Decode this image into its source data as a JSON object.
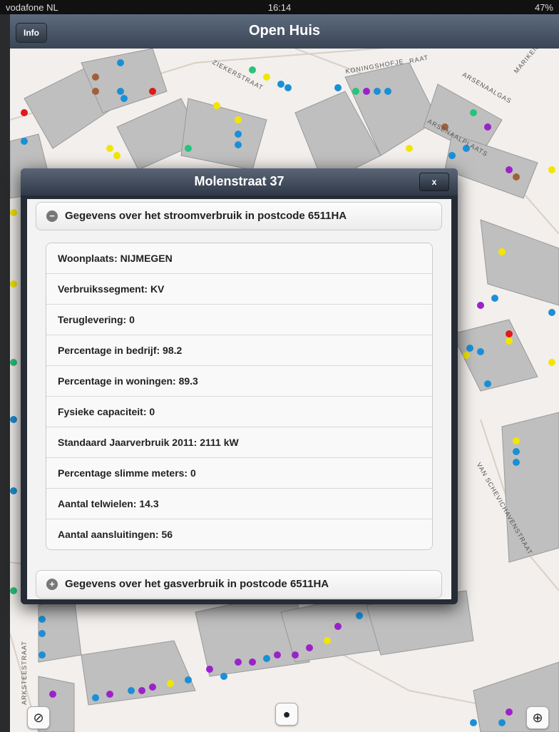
{
  "status_bar": {
    "carrier": "vodafone NL",
    "time": "16:14",
    "battery": "47%"
  },
  "navbar": {
    "info_label": "Info",
    "title": "Open Huis"
  },
  "map": {
    "streets": [
      "ZIEKERSTRAAT",
      "KONINGSHOFJE",
      "ARSENAALGAS",
      "MARIKEN",
      "ARSENAALPLAATS",
      "VAN SCHEVICHAVENSTRAAT",
      "ARKSTEESTRAAT",
      "RAAT"
    ],
    "dot_colors": {
      "blue": "#1b8fd6",
      "yellow": "#f2e600",
      "purple": "#9b22c9",
      "red": "#e01919",
      "brown": "#a0603c",
      "green": "#26c47a"
    }
  },
  "popup": {
    "title": "Molenstraat 37",
    "close_label": "x",
    "electricity_section": "Gegevens over het stroomverbruik in postcode 6511HA",
    "gas_section": "Gegevens over het gasverbruik in postcode 6511HA",
    "rows": [
      "Woonplaats: NIJMEGEN",
      "Verbruikssegment: KV",
      "Teruglevering: 0",
      "Percentage in bedrijf: 98.2",
      "Percentage in woningen: 89.3",
      "Fysieke capaciteit: 0",
      "Standaard Jaarverbruik 2011: 2111 kW",
      "Percentage slimme meters: 0",
      "Aantal telwielen: 14.3",
      "Aantal aansluitingen: 56"
    ]
  },
  "bottom_buttons": {
    "left_icon": "compass-icon",
    "center_icon": "lightbulb-icon",
    "right_icon": "locate-icon"
  }
}
